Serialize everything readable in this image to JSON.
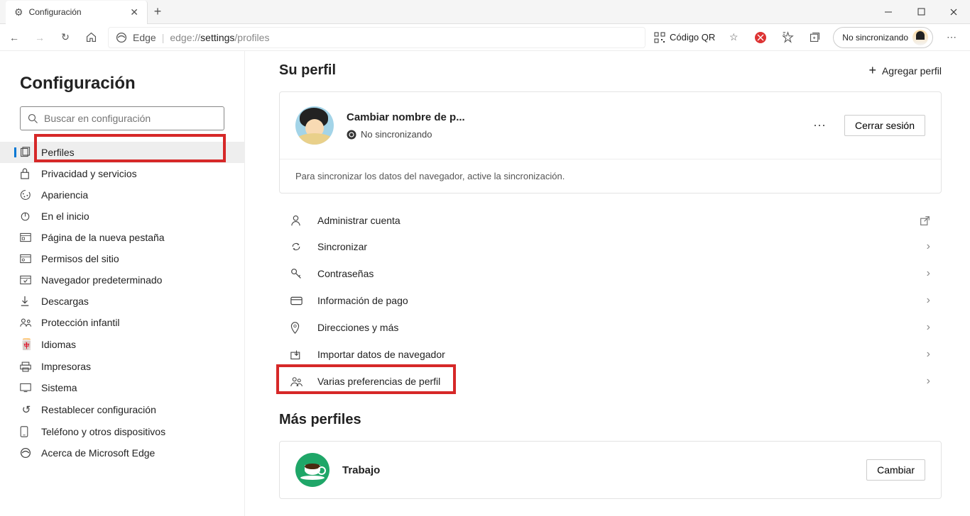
{
  "tab": {
    "title": "Configuración"
  },
  "addr": {
    "edge_label": "Edge",
    "url_prefix": "edge://",
    "url_mid": "settings",
    "url_suffix": "/profiles"
  },
  "toolbar_right": {
    "qr": "Código QR",
    "sync_pill": "No sincronizando"
  },
  "sidebar": {
    "heading": "Configuración",
    "search_placeholder": "Buscar en configuración",
    "items": [
      {
        "label": "Perfiles"
      },
      {
        "label": "Privacidad y servicios"
      },
      {
        "label": "Apariencia"
      },
      {
        "label": "En el inicio"
      },
      {
        "label": "Página de la nueva pestaña"
      },
      {
        "label": "Permisos del sitio"
      },
      {
        "label": "Navegador predeterminado"
      },
      {
        "label": "Descargas"
      },
      {
        "label": "Protección infantil"
      },
      {
        "label": "Idiomas"
      },
      {
        "label": "Impresoras"
      },
      {
        "label": "Sistema"
      },
      {
        "label": "Restablecer configuración"
      },
      {
        "label": "Teléfono y otros dispositivos"
      },
      {
        "label": "Acerca de Microsoft Edge"
      }
    ]
  },
  "main": {
    "heading": "Su perfil",
    "add_profile": "Agregar perfil",
    "profile": {
      "name": "Cambiar nombre de p...",
      "sync_status": "No sincronizando",
      "signout": "Cerrar sesión",
      "note": "Para sincronizar los datos del navegador, active la sincronización."
    },
    "links": [
      {
        "label": "Administrar cuenta",
        "ext": true
      },
      {
        "label": "Sincronizar"
      },
      {
        "label": "Contraseñas"
      },
      {
        "label": "Información de pago"
      },
      {
        "label": "Direcciones y más"
      },
      {
        "label": "Importar datos de navegador"
      },
      {
        "label": "Varias preferencias de perfil"
      }
    ],
    "more_heading": "Más perfiles",
    "other_profile": {
      "name": "Trabajo",
      "switch": "Cambiar"
    }
  }
}
